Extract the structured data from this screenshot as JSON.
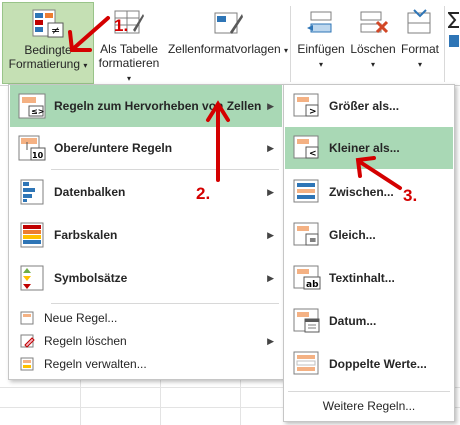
{
  "ribbon": {
    "cond_format_line1": "Bedingte",
    "cond_format_line2": "Formatierung",
    "table_line1": "Als Tabelle",
    "table_line2": "formatieren",
    "cellstyles_label": "Zellenformatvorlagen",
    "insert_label": "Einfügen",
    "delete_label": "Löschen",
    "format_label": "Format"
  },
  "menu_main": {
    "items": [
      {
        "label": "Regeln zum Hervorheben von Zellen"
      },
      {
        "label": "Obere/untere Regeln"
      },
      {
        "label": "Datenbalken"
      },
      {
        "label": "Farbskalen"
      },
      {
        "label": "Symbolsätze"
      }
    ],
    "small_items": [
      {
        "label": "Neue Regel..."
      },
      {
        "label": "Regeln löschen"
      },
      {
        "label": "Regeln verwalten..."
      }
    ]
  },
  "submenu": {
    "items": [
      {
        "label": "Größer als..."
      },
      {
        "label": "Kleiner als..."
      },
      {
        "label": "Zwischen..."
      },
      {
        "label": "Gleich..."
      },
      {
        "label": "Textinhalt..."
      },
      {
        "label": "Datum..."
      },
      {
        "label": "Doppelte Werte..."
      }
    ],
    "more_rules": "Weitere Regeln..."
  },
  "annotations": {
    "one": "1.",
    "two": "2.",
    "three": "3."
  },
  "colors": {
    "highlight": "#a9d8b5",
    "ribbon_active": "#c5e0b4",
    "arrow": "#d40000"
  }
}
